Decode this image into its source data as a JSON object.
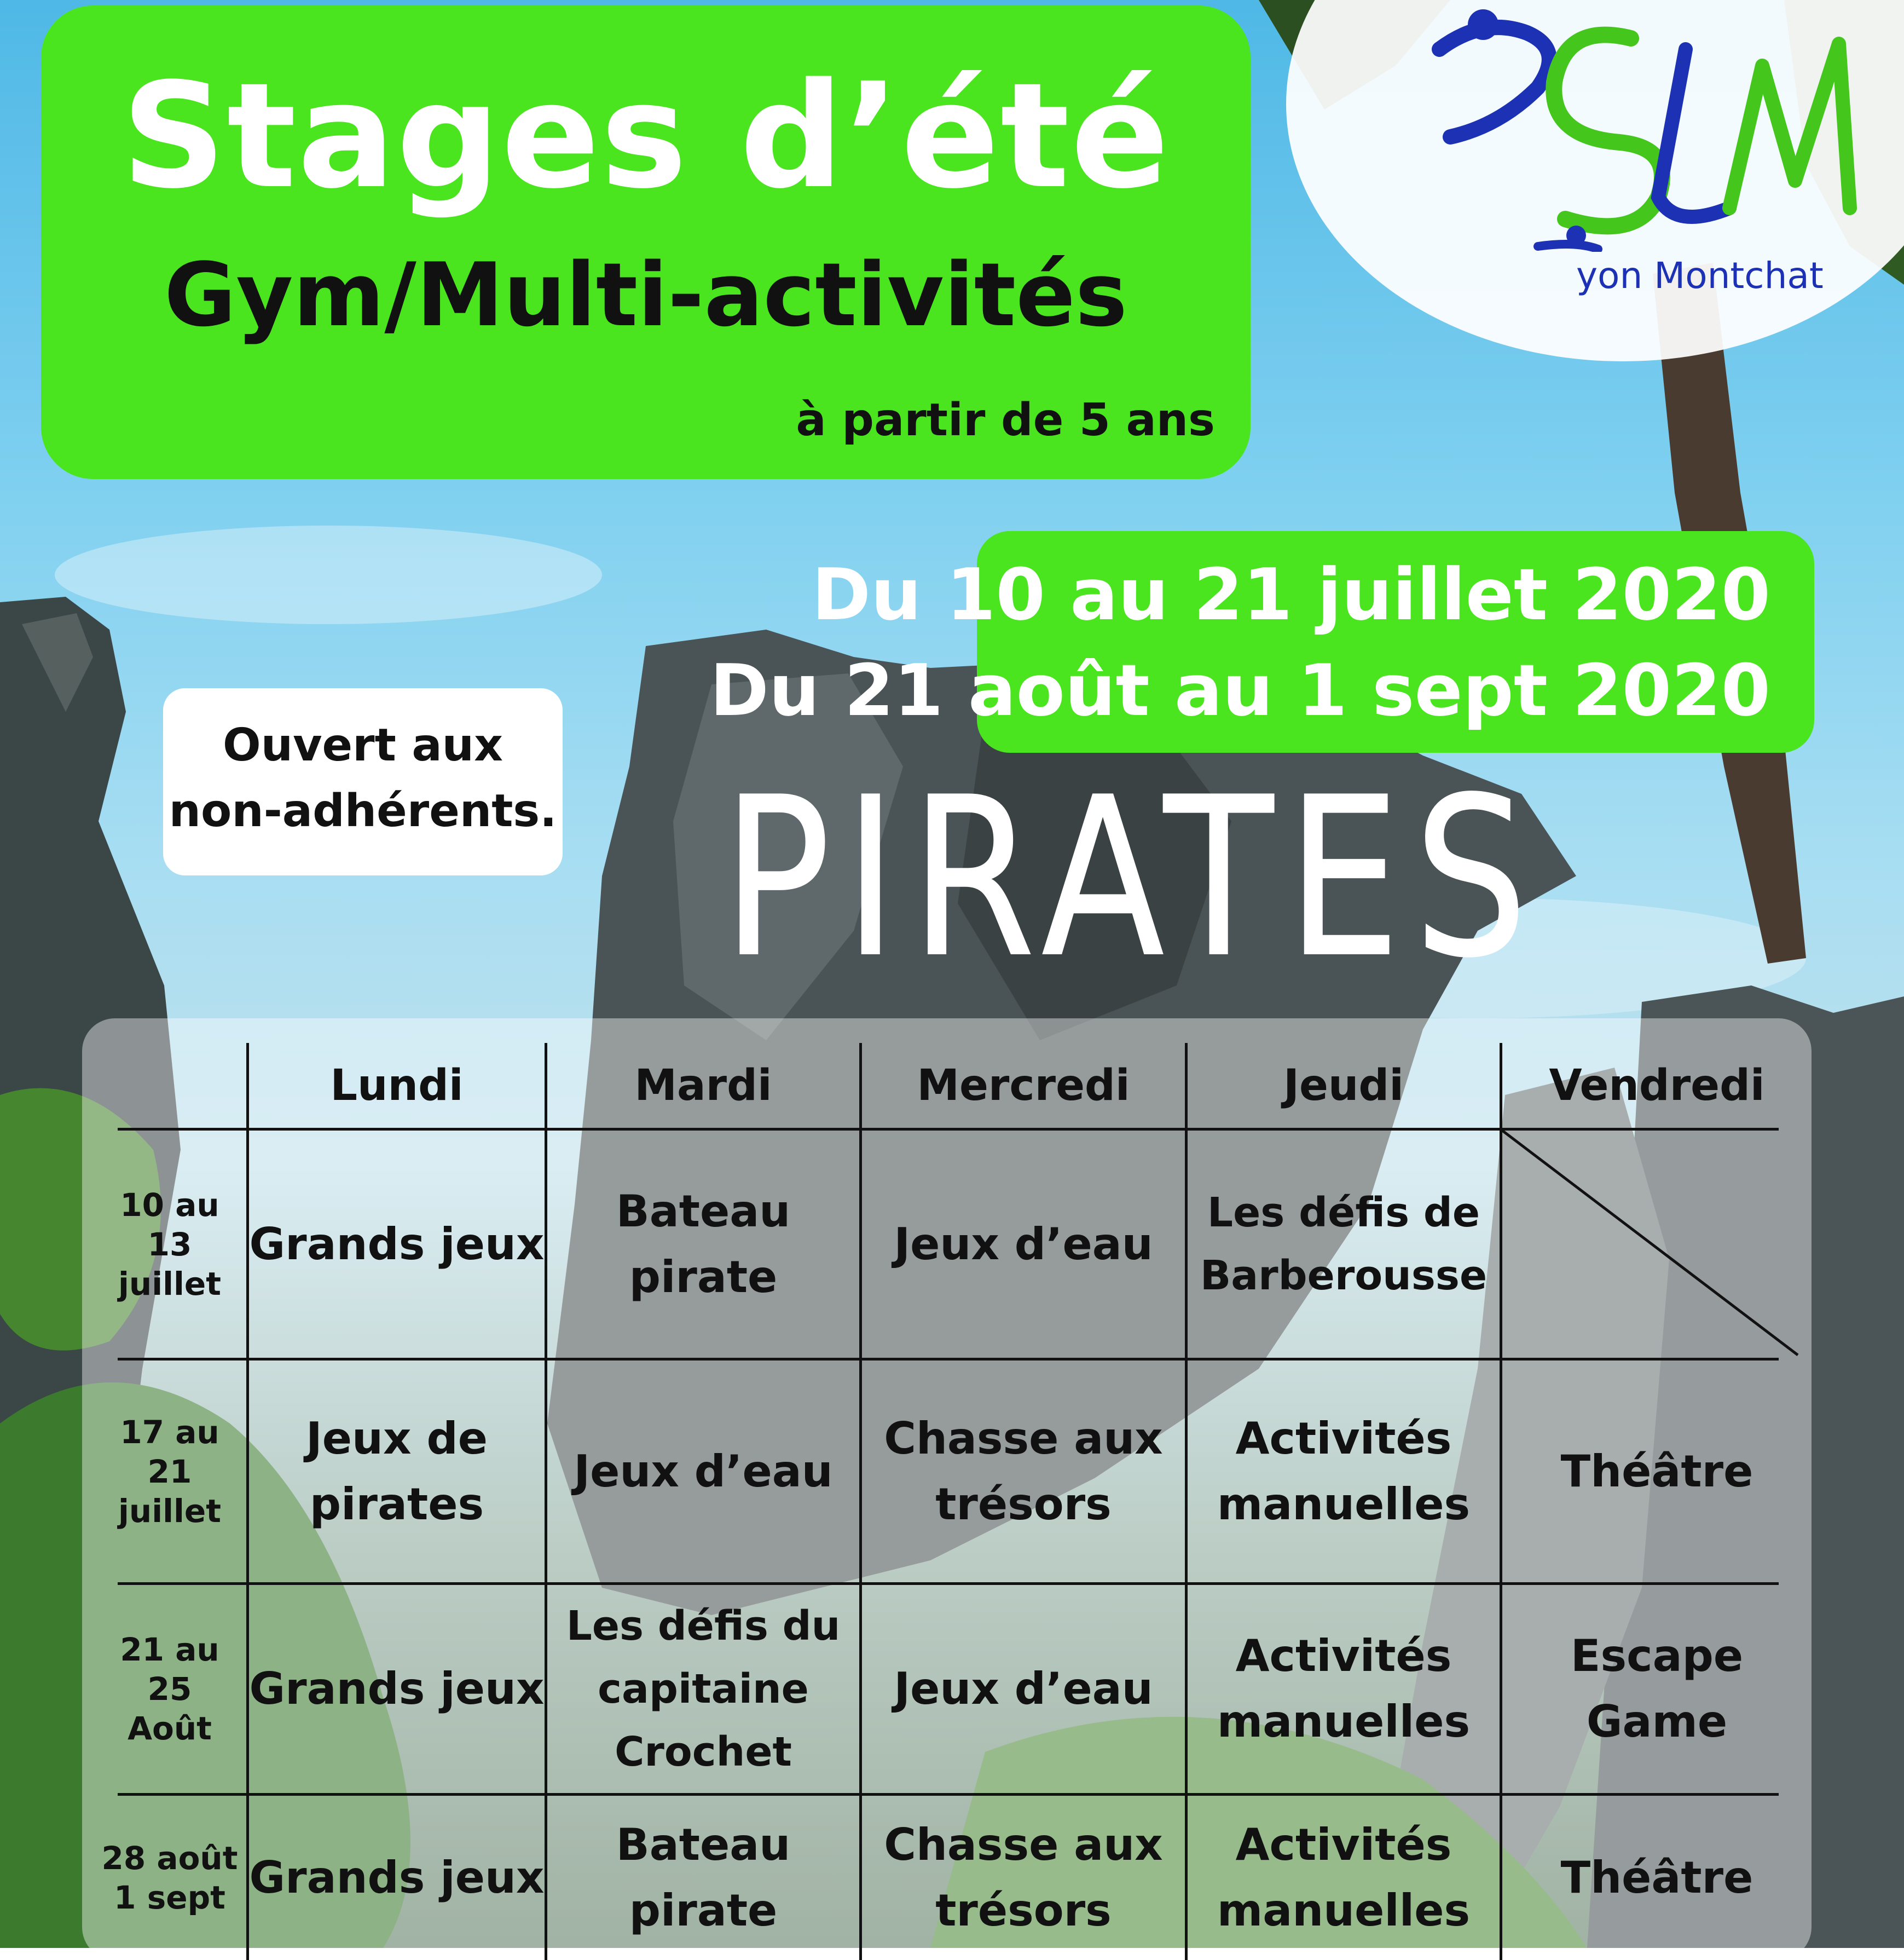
{
  "header": {
    "title": "Stages d’été",
    "subtitle": "Gym/Multi-activités",
    "age_note": "à partir de 5 ans"
  },
  "logo": {
    "text": "yon Montchat",
    "colors": {
      "blue": "#1c31b4",
      "green": "#44c61c"
    }
  },
  "dates": {
    "line1": "Du 10 au 21 juillet 2020",
    "line2": "Du 21 août au 1 sept 2020"
  },
  "open_note": {
    "line1": "Ouvert aux",
    "line2": "non-adhérents."
  },
  "theme": "PIRATES",
  "schedule": {
    "days": [
      "Lundi",
      "Mardi",
      "Mercredi",
      "Jeudi",
      "Vendredi"
    ],
    "weeks": [
      {
        "label": "10 au 13\njuillet",
        "activities": [
          "Grands jeux",
          "Bateau\npirate",
          "Jeux d’eau",
          "Les défis de\nBarberousse",
          ""
        ]
      },
      {
        "label": "17 au 21\njuillet",
        "activities": [
          "Jeux de\npirates",
          "Jeux d’eau",
          "Chasse aux\ntrésors",
          "Activités\nmanuelles",
          "Théâtre"
        ]
      },
      {
        "label": "21 au 25\nAoût",
        "activities": [
          "Grands jeux",
          "Les défis du\ncapitaine\nCrochet",
          "Jeux d’eau",
          "Activités\nmanuelles",
          "Escape Game"
        ]
      },
      {
        "label": "28 août\n1 sept",
        "activities": [
          "Grands jeux",
          "Bateau\npirate",
          "Chasse aux\ntrésors",
          "Activités\nmanuelles",
          "Théâtre"
        ]
      }
    ]
  },
  "colors": {
    "accent_green": "#4ae51f",
    "title_white": "#ffffff",
    "text_dark": "#111111"
  }
}
